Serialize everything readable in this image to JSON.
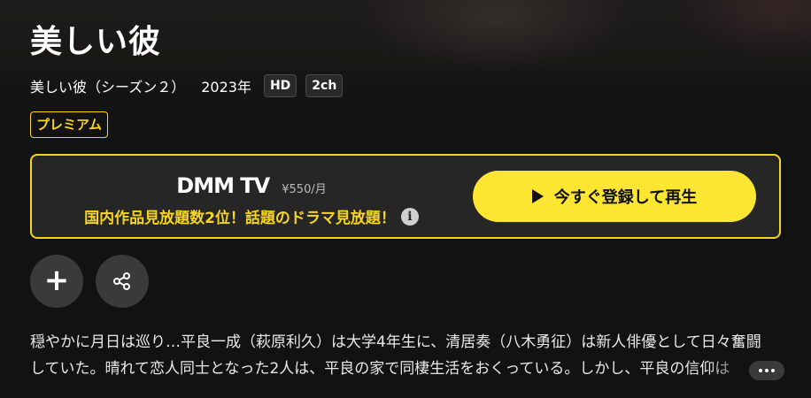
{
  "title": "美しい彼",
  "meta": {
    "season": "美しい彼（シーズン２）",
    "year": "2023年",
    "tags": [
      "HD",
      "2ch"
    ]
  },
  "badge": "プレミアム",
  "promo": {
    "brand": "DMM TV",
    "price": "¥550/月",
    "text": "国内作品見放題数2位！話題のドラマ見放題！",
    "info_icon": "info-icon",
    "cta_label": "今すぐ登録して再生",
    "cta_icon": "play-icon",
    "accent": "#f7d51d",
    "cta_color": "#fde631"
  },
  "actions": {
    "add_icon": "plus-icon",
    "share_icon": "share-icon"
  },
  "description": {
    "line1": "穏やかに月日は巡り…平良一成（萩原利久）は大学4年生に、清居奏（八木勇征）は新人俳優として日々奮闘",
    "line2": "していた。晴れて恋人同士となった2人は、平良の家で同棲生活をおくっている。しかし、平良の信仰は",
    "more_icon": "more-icon"
  }
}
